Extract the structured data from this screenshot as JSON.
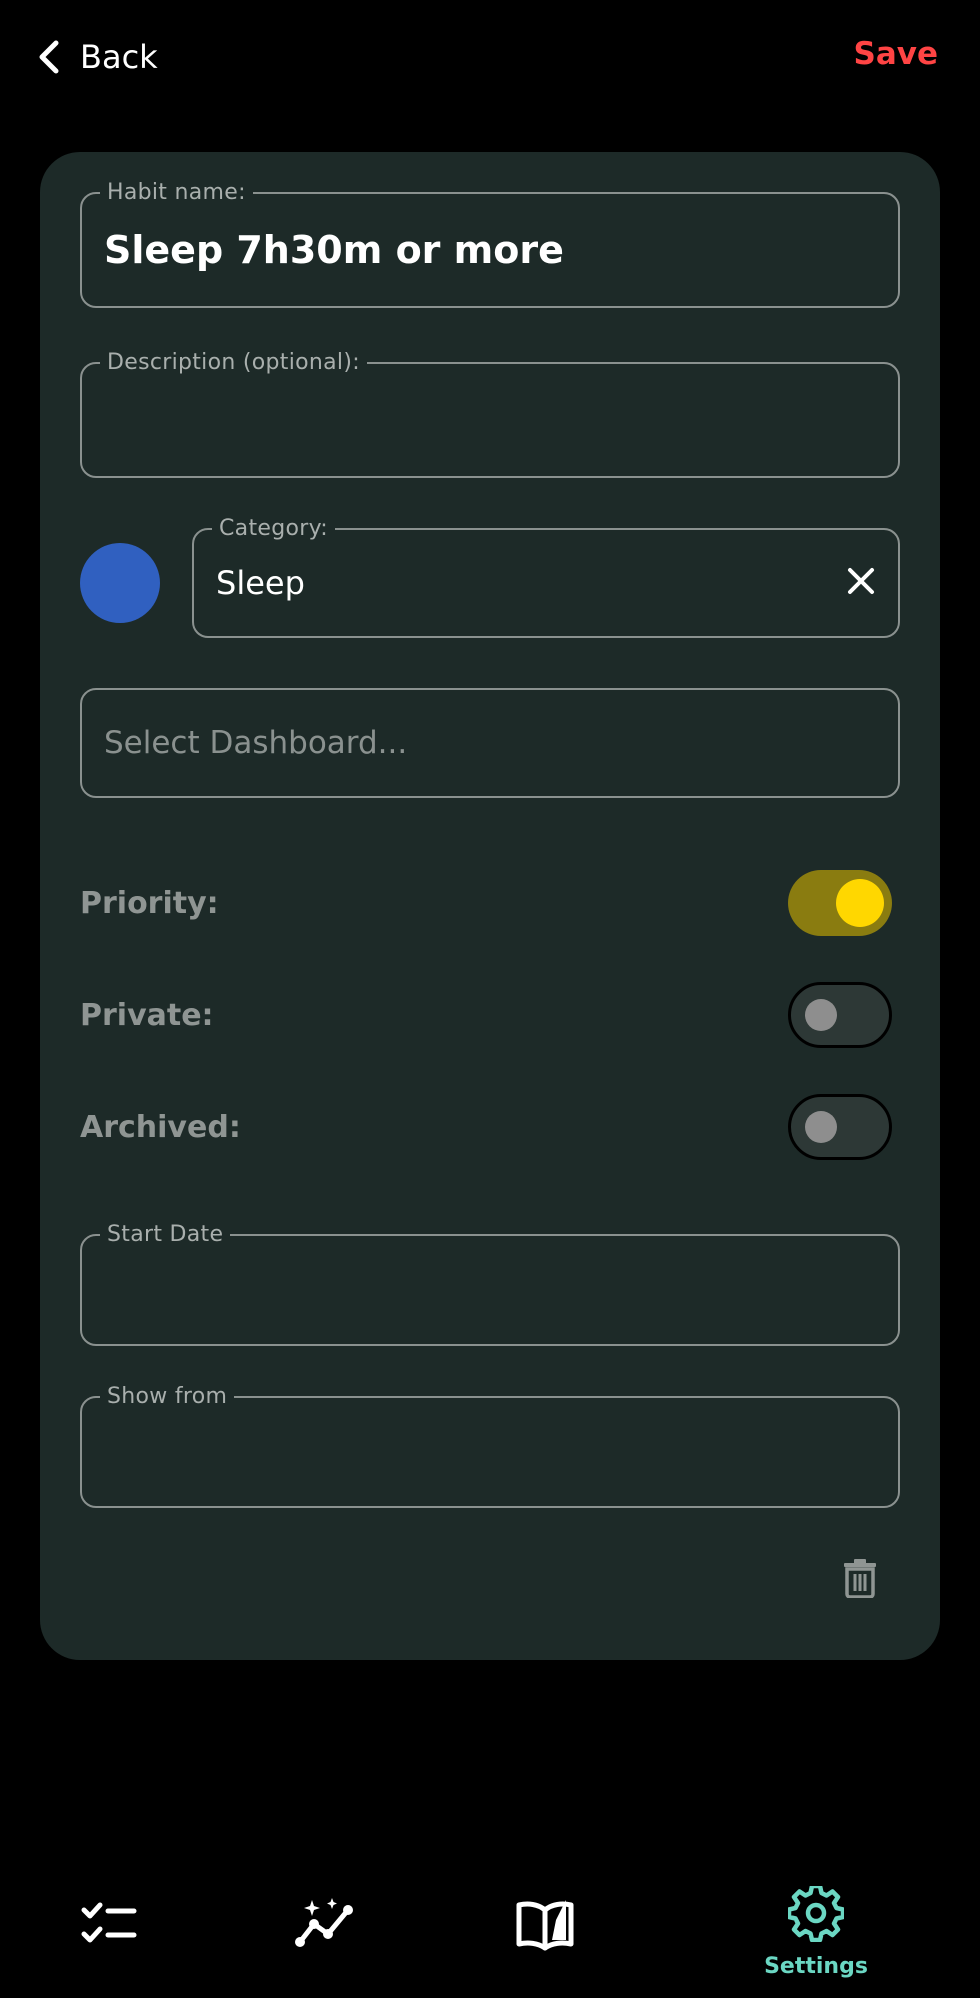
{
  "header": {
    "back_label": "Back",
    "save_label": "Save",
    "save_color": "#ff4444"
  },
  "form": {
    "habit_name": {
      "label": "Habit name:",
      "value": "Sleep 7h30m or more"
    },
    "description": {
      "label": "Description (optional):",
      "value": ""
    },
    "category": {
      "label": "Category:",
      "value": "Sleep",
      "color": "#3060c0"
    },
    "dashboard": {
      "placeholder": "Select Dashboard..."
    },
    "toggles": [
      {
        "label": "Priority:",
        "on": true
      },
      {
        "label": "Private:",
        "on": false
      },
      {
        "label": "Archived:",
        "on": false
      }
    ],
    "start_date": {
      "label": "Start Date",
      "value": ""
    },
    "show_from": {
      "label": "Show from",
      "value": ""
    }
  },
  "bottom_nav": {
    "items": [
      {
        "icon": "checklist-icon",
        "label": ""
      },
      {
        "icon": "trend-sparkle-icon",
        "label": ""
      },
      {
        "icon": "journal-book-icon",
        "label": ""
      },
      {
        "icon": "gear-icon",
        "label": "Settings",
        "active": true
      }
    ],
    "active_color": "#6bd7c3"
  }
}
